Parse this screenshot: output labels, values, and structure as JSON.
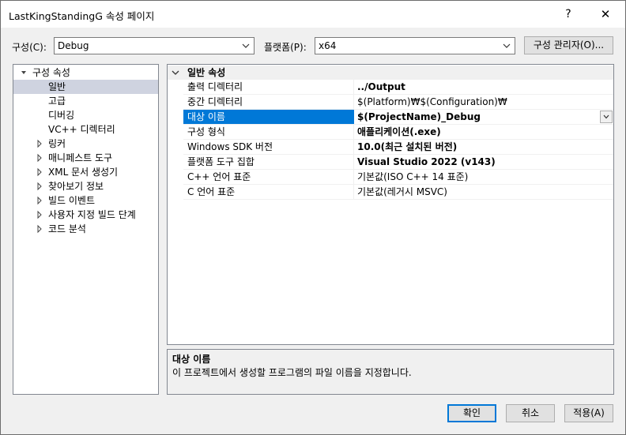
{
  "window": {
    "title": "LastKingStandingG 속성 페이지",
    "help": "?",
    "close": "✕"
  },
  "toolbar": {
    "config_label": "구성(C):",
    "config_value": "Debug",
    "platform_label": "플랫폼(P):",
    "platform_value": "x64",
    "config_manager_label": "구성 관리자(O)..."
  },
  "tree": {
    "root": "구성 속성",
    "items": [
      {
        "label": "일반",
        "selected": true,
        "expandable": false
      },
      {
        "label": "고급",
        "expandable": false
      },
      {
        "label": "디버깅",
        "expandable": false
      },
      {
        "label": "VC++ 디렉터리",
        "expandable": false
      },
      {
        "label": "링커",
        "expandable": true
      },
      {
        "label": "매니페스트 도구",
        "expandable": true
      },
      {
        "label": "XML 문서 생성기",
        "expandable": true
      },
      {
        "label": "찾아보기 정보",
        "expandable": true
      },
      {
        "label": "빌드 이벤트",
        "expandable": true
      },
      {
        "label": "사용자 지정 빌드 단계",
        "expandable": true
      },
      {
        "label": "코드 분석",
        "expandable": true
      }
    ]
  },
  "grid": {
    "category": "일반 속성",
    "rows": [
      {
        "name": "출력 디렉터리",
        "value": "../Output",
        "bold": true
      },
      {
        "name": "중간 디렉터리",
        "value": "$(Platform)₩$(Configuration)₩",
        "bold": false
      },
      {
        "name": "대상 이름",
        "value": "$(ProjectName)_Debug",
        "bold": true,
        "selected": true
      },
      {
        "name": "구성 형식",
        "value": "애플리케이션(.exe)",
        "bold": true
      },
      {
        "name": "Windows SDK 버전",
        "value": "10.0(최근 설치된 버전)",
        "bold": true
      },
      {
        "name": "플랫폼 도구 집합",
        "value": "Visual Studio 2022 (v143)",
        "bold": true
      },
      {
        "name": "C++ 언어 표준",
        "value": "기본값(ISO C++ 14 표준)",
        "bold": false
      },
      {
        "name": "C 언어 표준",
        "value": "기본값(레거시 MSVC)",
        "bold": false
      }
    ]
  },
  "description": {
    "title": "대상 이름",
    "text": "이 프로젝트에서 생성할 프로그램의 파일 이름을 지정합니다."
  },
  "buttons": {
    "ok": "확인",
    "cancel": "취소",
    "apply": "적용(A)"
  },
  "colors": {
    "accent": "#0078d7",
    "tree_selection": "#cfd3e0"
  }
}
